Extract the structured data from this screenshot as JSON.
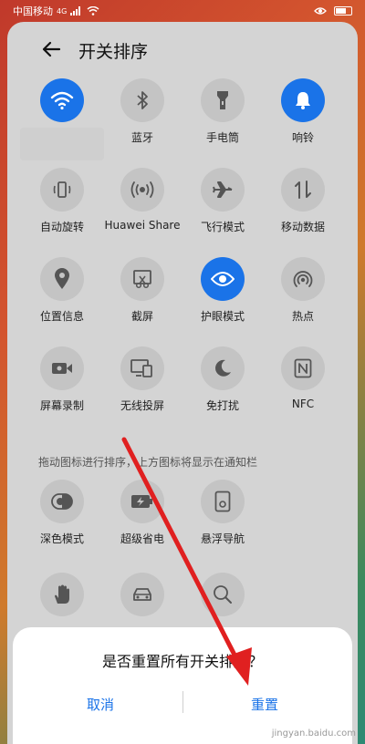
{
  "status_bar": {
    "carrier": "中国移动",
    "network": "4G"
  },
  "header": {
    "title": "开关排序"
  },
  "tiles": [
    {
      "label": "",
      "icon": "wifi-icon",
      "active": true
    },
    {
      "label": "蓝牙",
      "icon": "bluetooth-icon",
      "active": false
    },
    {
      "label": "手电筒",
      "icon": "flashlight-icon",
      "active": false
    },
    {
      "label": "响铃",
      "icon": "bell-icon",
      "active": true
    },
    {
      "label": "自动旋转",
      "icon": "rotate-icon",
      "active": false
    },
    {
      "label": "Huawei Share",
      "icon": "share-icon",
      "active": false
    },
    {
      "label": "飞行模式",
      "icon": "airplane-icon",
      "active": false
    },
    {
      "label": "移动数据",
      "icon": "mobile-data-icon",
      "active": false
    },
    {
      "label": "位置信息",
      "icon": "location-icon",
      "active": false
    },
    {
      "label": "截屏",
      "icon": "screenshot-icon",
      "active": false
    },
    {
      "label": "护眼模式",
      "icon": "eye-icon",
      "active": true
    },
    {
      "label": "热点",
      "icon": "hotspot-icon",
      "active": false
    },
    {
      "label": "屏幕录制",
      "icon": "video-record-icon",
      "active": false
    },
    {
      "label": "无线投屏",
      "icon": "cast-icon",
      "active": false
    },
    {
      "label": "免打扰",
      "icon": "moon-icon",
      "active": false
    },
    {
      "label": "NFC",
      "icon": "nfc-icon",
      "active": false
    }
  ],
  "section": {
    "title": "拖动图标进行排序，上方图标将显示在通知栏"
  },
  "extra_tiles": [
    {
      "label": "深色模式",
      "icon": "dark-mode-icon"
    },
    {
      "label": "超级省电",
      "icon": "battery-saver-icon"
    },
    {
      "label": "悬浮导航",
      "icon": "float-nav-icon"
    },
    {
      "label": "",
      "icon": "hand-icon"
    },
    {
      "label": "",
      "icon": "car-icon"
    },
    {
      "label": "",
      "icon": "search-icon"
    }
  ],
  "dialog": {
    "message": "是否重置所有开关排序？",
    "cancel": "取消",
    "confirm": "重置"
  },
  "watermark": "jingyan.baidu.com",
  "colors": {
    "accent": "#1a73e8",
    "arrow": "#e02020"
  }
}
